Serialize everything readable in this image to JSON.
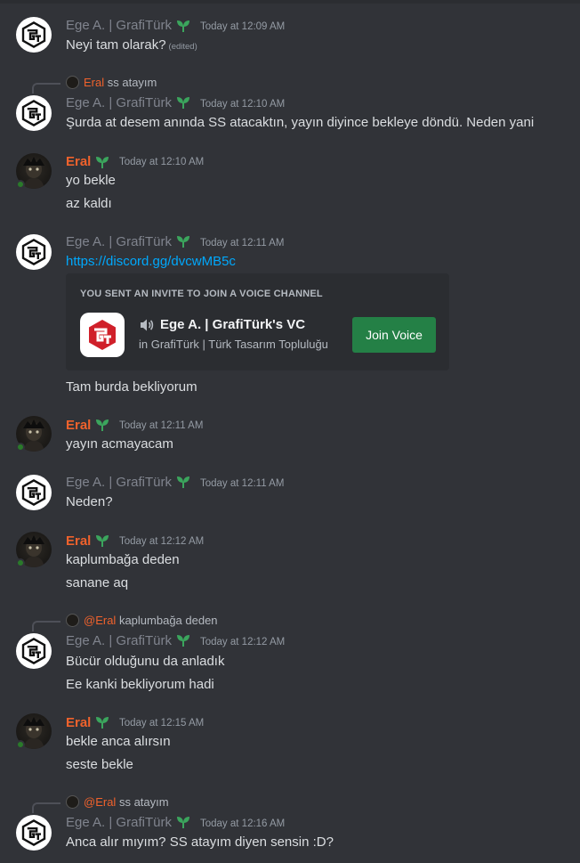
{
  "colors": {
    "background": "#313338",
    "username_eral": "#f0622c",
    "username_ege": "#80848e",
    "link": "#00a8fc",
    "join_button": "#248046",
    "leaf_badge": "#3ba55d"
  },
  "users": {
    "ege": "Ege A. | GrafiTürk",
    "eral": "Eral"
  },
  "messages": [
    {
      "author": "Ege A. | GrafiTürk",
      "time": "Today at 12:09 AM",
      "lines": [
        "Neyi tam olarak?"
      ],
      "edited": "(edited)"
    },
    {
      "reply": {
        "name": "Eral",
        "text": "ss atayım"
      },
      "author": "Ege A. | GrafiTürk",
      "time": "Today at 12:10 AM",
      "lines": [
        "Şurda at desem anında SS atacaktın, yayın diyince bekleye döndü. Neden yani"
      ]
    },
    {
      "author": "Eral",
      "time": "Today at 12:10 AM",
      "lines": [
        "yo bekle",
        "az kaldı"
      ]
    },
    {
      "author": "Ege A. | GrafiTürk",
      "time": "Today at 12:11 AM",
      "link": "https://discord.gg/dvcwMB5c",
      "after": "Tam burda bekliyorum"
    },
    {
      "author": "Eral",
      "time": "Today at 12:11 AM",
      "lines": [
        "yayın acmayacam"
      ]
    },
    {
      "author": "Ege A. | GrafiTürk",
      "time": "Today at 12:11 AM",
      "lines": [
        "Neden?"
      ]
    },
    {
      "author": "Eral",
      "time": "Today at 12:12 AM",
      "lines": [
        "kaplumbağa deden",
        "sanane aq"
      ]
    },
    {
      "reply": {
        "name": "@Eral",
        "text": "kaplumbağa deden"
      },
      "author": "Ege A. | GrafiTürk",
      "time": "Today at 12:12 AM",
      "lines": [
        "Bücür olduğunu da anladık",
        "Ee kanki bekliyorum hadi"
      ]
    },
    {
      "author": "Eral",
      "time": "Today at 12:15 AM",
      "lines": [
        "bekle anca alırsın",
        "seste bekle"
      ]
    },
    {
      "reply": {
        "name": "@Eral",
        "text": "ss atayım"
      },
      "author": "Ege A. | GrafiTürk",
      "time": "Today at 12:16 AM",
      "lines": [
        "Anca alır mıyım? SS atayım diyen sensin :D?"
      ]
    }
  ],
  "invite": {
    "header": "YOU SENT AN INVITE TO JOIN A VOICE CHANNEL",
    "channel": "Ege A. | GrafiTürk's VC",
    "server": "in GrafiTürk | Türk Tasarım Topluluğu",
    "button": "Join Voice"
  }
}
